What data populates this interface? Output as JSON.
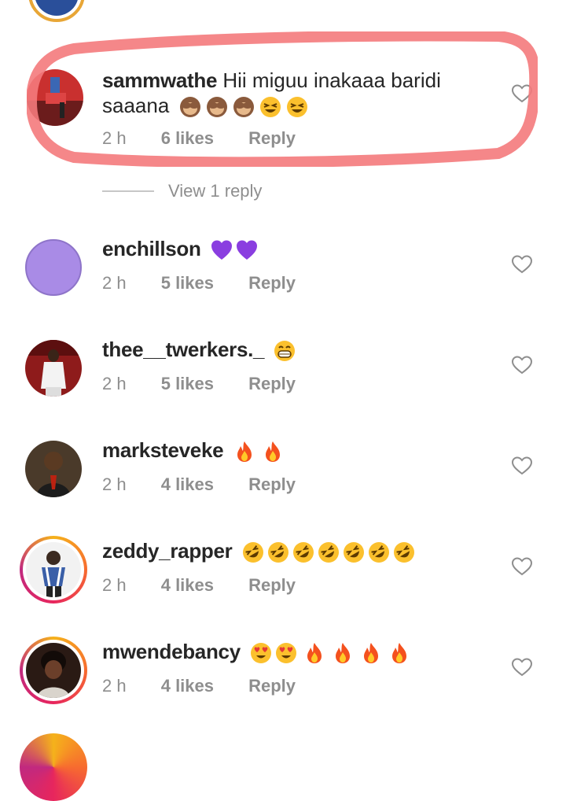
{
  "comments": [
    {
      "username": "sammwathe",
      "text_line1": "Hii miguu inakaaa baridi",
      "text_line2": "saaana",
      "time": "2 h",
      "likes": "6 likes",
      "reply": "Reply",
      "emojis": [
        "see-no-evil-monkey",
        "see-no-evil-monkey",
        "see-no-evil-monkey",
        "squinting-face",
        "squinting-face"
      ]
    },
    {
      "username": "enchillson",
      "text": "",
      "time": "2 h",
      "likes": "5 likes",
      "reply": "Reply",
      "emojis": [
        "purple-heart",
        "purple-heart"
      ]
    },
    {
      "username": "thee__twerkers._",
      "text": "",
      "time": "2 h",
      "likes": "5 likes",
      "reply": "Reply",
      "emojis": [
        "grinning-face"
      ]
    },
    {
      "username": "marksteveke",
      "text": "",
      "time": "2 h",
      "likes": "4 likes",
      "reply": "Reply",
      "emojis": [
        "fire",
        "fire"
      ]
    },
    {
      "username": "zeddy_rapper",
      "text": "",
      "time": "2 h",
      "likes": "4 likes",
      "reply": "Reply",
      "emojis": [
        "rofl",
        "rofl",
        "rofl",
        "rofl",
        "rofl",
        "rofl",
        "rofl"
      ]
    },
    {
      "username": "mwendebancy",
      "text": "",
      "time": "2 h",
      "likes": "4 likes",
      "reply": "Reply",
      "emojis": [
        "heart-eyes",
        "heart-eyes",
        "fire",
        "fire",
        "fire",
        "fire"
      ]
    }
  ],
  "view_replies": "View 1 reply",
  "colors": {
    "highlight": "#f47a7c",
    "purple_avatar": "#a98be6",
    "meta": "#8e8e8e",
    "text": "#262626"
  }
}
